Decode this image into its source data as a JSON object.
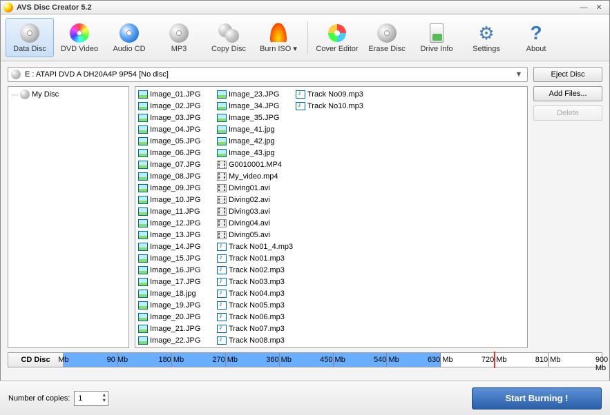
{
  "app": {
    "title": "AVS Disc Creator 5.2"
  },
  "toolbar": [
    {
      "id": "data-disc",
      "label": "Data Disc",
      "icon": "disc-gray",
      "active": true
    },
    {
      "id": "dvd-video",
      "label": "DVD Video",
      "icon": "disc-color"
    },
    {
      "id": "audio-cd",
      "label": "Audio CD",
      "icon": "disc-blue"
    },
    {
      "id": "mp3",
      "label": "MP3",
      "icon": "disc-gray"
    },
    {
      "id": "copy-disc",
      "label": "Copy Disc",
      "icon": "copy"
    },
    {
      "id": "burn-iso",
      "label": "Burn ISO",
      "icon": "fire",
      "dropdown": true
    },
    {
      "sep": true
    },
    {
      "id": "cover-editor",
      "label": "Cover Editor",
      "icon": "cover"
    },
    {
      "id": "erase-disc",
      "label": "Erase Disc",
      "icon": "disc-gray"
    },
    {
      "id": "drive-info",
      "label": "Drive Info",
      "icon": "info"
    },
    {
      "id": "settings",
      "label": "Settings",
      "icon": "gear"
    },
    {
      "id": "about",
      "label": "About",
      "icon": "help"
    }
  ],
  "drive": {
    "text": "E : ATAPI   DVD A  DH20A4P   9P54        [No disc]"
  },
  "buttons": {
    "eject": "Eject Disc",
    "addfiles": "Add Files...",
    "delete": "Delete"
  },
  "tree": {
    "root": "My Disc"
  },
  "files": [
    {
      "n": "Image_01.JPG",
      "t": "img"
    },
    {
      "n": "Image_02.JPG",
      "t": "img"
    },
    {
      "n": "Image_03.JPG",
      "t": "img"
    },
    {
      "n": "Image_04.JPG",
      "t": "img"
    },
    {
      "n": "Image_05.JPG",
      "t": "img"
    },
    {
      "n": "Image_06.JPG",
      "t": "img"
    },
    {
      "n": "Image_07.JPG",
      "t": "img"
    },
    {
      "n": "Image_08.JPG",
      "t": "img"
    },
    {
      "n": "Image_09.JPG",
      "t": "img"
    },
    {
      "n": "Image_10.JPG",
      "t": "img"
    },
    {
      "n": "Image_11.JPG",
      "t": "img"
    },
    {
      "n": "Image_12.JPG",
      "t": "img"
    },
    {
      "n": "Image_13.JPG",
      "t": "img"
    },
    {
      "n": "Image_14.JPG",
      "t": "img"
    },
    {
      "n": "Image_15.JPG",
      "t": "img"
    },
    {
      "n": "Image_16.JPG",
      "t": "img"
    },
    {
      "n": "Image_17.JPG",
      "t": "img"
    },
    {
      "n": "Image_18.jpg",
      "t": "img"
    },
    {
      "n": "Image_19.JPG",
      "t": "img"
    },
    {
      "n": "Image_20.JPG",
      "t": "img"
    },
    {
      "n": "Image_21.JPG",
      "t": "img"
    },
    {
      "n": "Image_22.JPG",
      "t": "img"
    },
    {
      "n": "Image_23.JPG",
      "t": "img"
    },
    {
      "n": "Image_34.JPG",
      "t": "img"
    },
    {
      "n": "Image_35.JPG",
      "t": "img"
    },
    {
      "n": "Image_41.jpg",
      "t": "img"
    },
    {
      "n": "Image_42.jpg",
      "t": "img"
    },
    {
      "n": "Image_43.jpg",
      "t": "img"
    },
    {
      "n": "G0010001.MP4",
      "t": "vid"
    },
    {
      "n": "My_video.mp4",
      "t": "vid"
    },
    {
      "n": "Diving01.avi",
      "t": "vid"
    },
    {
      "n": "Diving02.avi",
      "t": "vid"
    },
    {
      "n": "Diving03.avi",
      "t": "vid"
    },
    {
      "n": "Diving04.avi",
      "t": "vid"
    },
    {
      "n": "Diving05.avi",
      "t": "vid"
    },
    {
      "n": "Track No01_4.mp3",
      "t": "aud"
    },
    {
      "n": "Track No01.mp3",
      "t": "aud"
    },
    {
      "n": "Track No02.mp3",
      "t": "aud"
    },
    {
      "n": "Track No03.mp3",
      "t": "aud"
    },
    {
      "n": "Track No04.mp3",
      "t": "aud"
    },
    {
      "n": "Track No05.mp3",
      "t": "aud"
    },
    {
      "n": "Track No06.mp3",
      "t": "aud"
    },
    {
      "n": "Track No07.mp3",
      "t": "aud"
    },
    {
      "n": "Track No08.mp3",
      "t": "aud"
    },
    {
      "n": "Track No09.mp3",
      "t": "aud"
    },
    {
      "n": "Track No10.mp3",
      "t": "aud"
    }
  ],
  "capacity": {
    "label": "CD Disc",
    "ticks": [
      "Mb",
      "90 Mb",
      "180 Mb",
      "270 Mb",
      "360 Mb",
      "450 Mb",
      "540 Mb",
      "630 Mb",
      "720 Mb",
      "810 Mb",
      "900 Mb"
    ],
    "red_at_index": 8,
    "fill_percent": 70
  },
  "footer": {
    "copies_label": "Number of copies:",
    "copies_value": "1",
    "start": "Start Burning !"
  }
}
